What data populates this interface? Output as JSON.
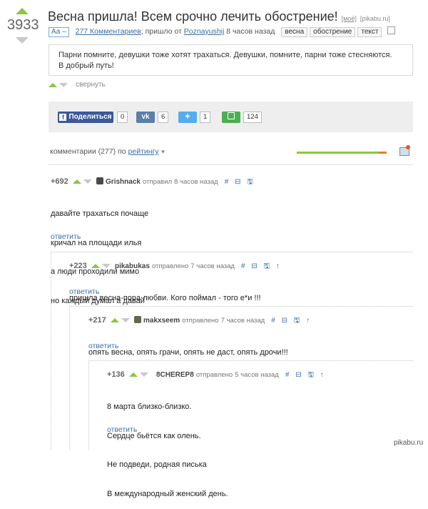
{
  "post": {
    "rating": "3933",
    "title": "Весна пришла! Всем срочно лечить обострение!",
    "title_tag_mine": "[моё]",
    "title_tag_source": "[pikabu.ru]",
    "aa_label": "Аа –",
    "comments_link": "277 Комментариев",
    "came_from": "; пришло от",
    "author": "Poznayushij",
    "time_ago": "8 часов назад",
    "tags": [
      "весна",
      "обострение",
      "текст"
    ],
    "body_lines": [
      "Парни помните, девушки тоже хотят трахаться. Девушки, помните, парни тоже стесняются.",
      "В добрый путь!"
    ],
    "collapse_label": "свернуть"
  },
  "share": {
    "facebook_label": "Поделиться",
    "facebook_count": "0",
    "vk_count": "6",
    "twitter_count": "1",
    "save_count": "124",
    "colors": {
      "facebook": "#3b5998",
      "vk": "#5b7fa6",
      "twitter": "#55acee",
      "save": "#4caf50"
    }
  },
  "comments_header": {
    "label": "комментарии (277) по",
    "sort": "рейтингу"
  },
  "comments": [
    {
      "rating": "+692",
      "user": "Grishnack",
      "action": "отправил",
      "time": "8 часов назад",
      "icons": "# ⊟ 🖫",
      "lines": [
        "давайте трахаться почаще",
        "кричал на площади илья",
        "а люди проходили мимо",
        "но каждый думал а давай"
      ],
      "reply": "ответить"
    },
    {
      "rating": "+223",
      "user": "pikabukas",
      "action": "отправлено",
      "time": "7 часов назад",
      "icons": "# ⊟ 🖫 ↑",
      "lines": [
        "пришла весна-пора любви. Кого поймал - того е*и !!!"
      ],
      "reply": "ответить"
    },
    {
      "rating": "+217",
      "user": "makxseem",
      "action": "отправлено",
      "time": "7 часов назад",
      "icons": "# ⊟ 🖫 ↑",
      "lines": [
        "опять весна, опять грачи, опять не даст, опять дрочи!!!"
      ],
      "reply": "ответить"
    },
    {
      "rating": "+136",
      "user": "8CHEREP8",
      "action": "отправлено",
      "time": "5 часов назад",
      "icons": "# ⊟ 🖫 ↑",
      "lines": [
        "8 марта близко-близко.",
        "Сердце бьётся как олень.",
        "Не подведи, родная писька",
        "В международный женский день."
      ],
      "reply": "ответить"
    }
  ],
  "watermark": "pikabu.ru"
}
